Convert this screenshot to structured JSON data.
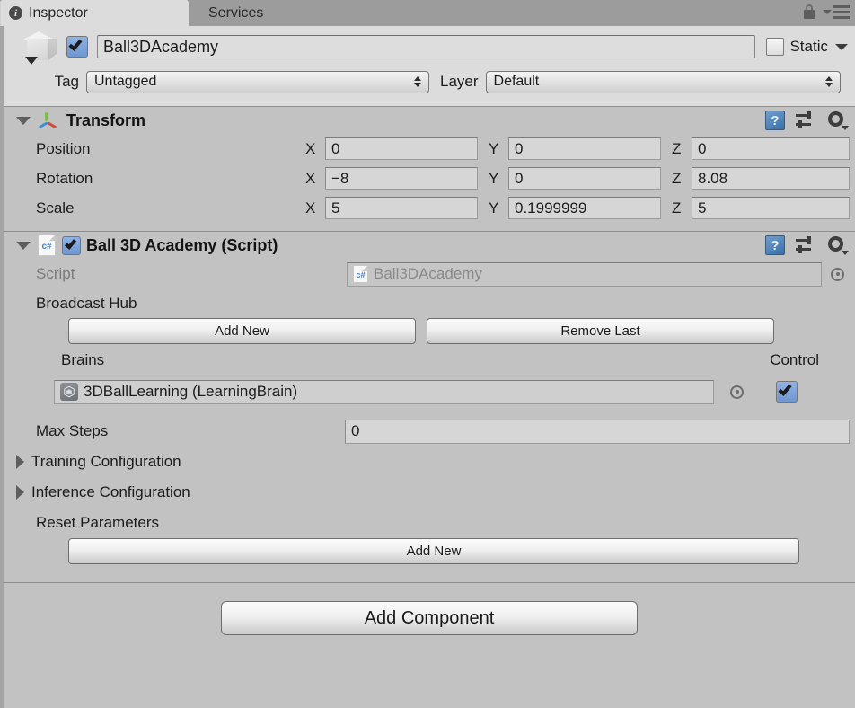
{
  "window": {
    "tabs": [
      {
        "label": "Inspector",
        "icon": "info-icon",
        "active": true
      },
      {
        "label": "Services",
        "icon": "",
        "active": false
      }
    ],
    "lock_icon": "lock-icon",
    "menu_icon": "hamburger-menu-icon"
  },
  "gameobject": {
    "icon": "cube-prefab-icon",
    "enabled": true,
    "name": "Ball3DAcademy",
    "static_label": "Static",
    "static_checked": false,
    "tag_label": "Tag",
    "tag_value": "Untagged",
    "layer_label": "Layer",
    "layer_value": "Default"
  },
  "transform": {
    "title": "Transform",
    "icon": "transform-axis-icon",
    "expanded": true,
    "help_icon": "help-book-icon",
    "preset_icon": "preset-sliders-icon",
    "settings_icon": "gear-icon",
    "rows": [
      {
        "label": "Position",
        "x": "0",
        "y": "0",
        "z": "0"
      },
      {
        "label": "Rotation",
        "x": "−8",
        "y": "0",
        "z": "8.08"
      },
      {
        "label": "Scale",
        "x": "5",
        "y": "0.1999999",
        "z": "5"
      }
    ],
    "axis_x": "X",
    "axis_y": "Y",
    "axis_z": "Z"
  },
  "script_component": {
    "title": "Ball 3D Academy (Script)",
    "icon": "csharp-script-icon",
    "enabled": true,
    "expanded": true,
    "help_icon": "help-book-icon",
    "preset_icon": "preset-sliders-icon",
    "settings_icon": "gear-icon",
    "script_label": "Script",
    "script_value": "Ball3DAcademy",
    "script_picker_icon": "object-picker-icon",
    "broadcast_hub_label": "Broadcast Hub",
    "add_new_label": "Add New",
    "remove_last_label": "Remove Last",
    "brains_label": "Brains",
    "control_label": "Control",
    "brain_value": "3DBallLearning (LearningBrain)",
    "brain_icon": "unity-asset-icon",
    "brain_picker_icon": "object-picker-icon",
    "control_checked": true,
    "max_steps_label": "Max Steps",
    "max_steps_value": "0",
    "training_config_label": "Training Configuration",
    "training_config_expanded": false,
    "inference_config_label": "Inference Configuration",
    "inference_config_expanded": false,
    "reset_parameters_label": "Reset Parameters",
    "reset_add_new_label": "Add New"
  },
  "footer": {
    "add_component_label": "Add Component"
  },
  "colors": {
    "panel_bg": "#c2c2c2",
    "header_bg": "#dcdcdc",
    "tabbar_bg": "#9c9c9c",
    "checkbox_blue": "#7fa5db",
    "text": "#1c1c1c",
    "dim_text": "#7b7b7b"
  }
}
